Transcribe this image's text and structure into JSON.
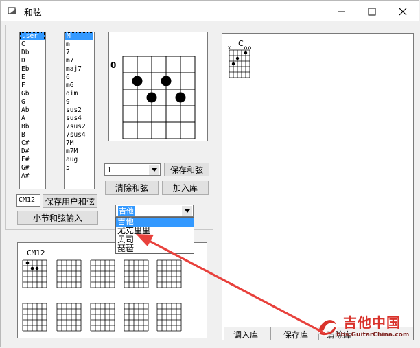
{
  "window": {
    "title": "和弦",
    "controls": {
      "minimize": "—",
      "maximize": "☐",
      "close": "✕"
    }
  },
  "root_list": {
    "items": [
      "user",
      "C",
      "Db",
      "D",
      "Eb",
      "E",
      "F",
      "Gb",
      "G",
      "Ab",
      "A",
      "Bb",
      "B",
      "C#",
      "D#",
      "F#",
      "G#",
      "A#"
    ],
    "selected": "user"
  },
  "type_list": {
    "items": [
      "M",
      "m",
      "7",
      "m7",
      "maj7",
      "6",
      "m6",
      "dim",
      "9",
      "sus2",
      "sus4",
      "7sus2",
      "7sus4",
      "7M",
      "m7M",
      "aug",
      "5"
    ],
    "selected": "M"
  },
  "chord_diagram": {
    "fret_label": "0",
    "dots": [
      {
        "string": 2,
        "fret": 2
      },
      {
        "string": 4,
        "fret": 2
      },
      {
        "string": 3,
        "fret": 3
      },
      {
        "string": 5,
        "fret": 3
      }
    ]
  },
  "controls": {
    "count_value": "1",
    "save_chord": "保存和弦",
    "clear_chord": "清除和弦",
    "add_library": "加入库",
    "user_chord_name": "CM12",
    "save_user_chord": "保存用户和弦",
    "measure_input": "小节和弦输入"
  },
  "instrument": {
    "selected": "吉他",
    "options": [
      "吉他",
      "尤克里里",
      "贝司",
      "琵琶"
    ],
    "highlighted": "吉他"
  },
  "preview": {
    "label": "CM12",
    "first_dots": [
      {
        "string": 2,
        "fret": 1
      },
      {
        "string": 3,
        "fret": 2
      },
      {
        "string": 4,
        "fret": 2
      }
    ]
  },
  "library": {
    "chord_name": "C",
    "open_marks": [
      "x",
      "o",
      "o"
    ],
    "dots": [
      {
        "string": 5,
        "fret": 1
      },
      {
        "string": 3,
        "fret": 2
      },
      {
        "string": 2,
        "fret": 3
      }
    ],
    "tabs": [
      "调入库",
      "保存库",
      "清除库"
    ]
  },
  "watermark": {
    "name": "吉他中国",
    "url": "bbs.GuitarChina.com"
  },
  "colors": {
    "selection": "#3399ff",
    "annotation_arrow": "#e8413c"
  }
}
